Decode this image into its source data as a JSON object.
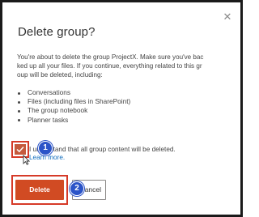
{
  "dialog": {
    "title": "Delete group?",
    "close_icon": "close-icon",
    "description_lines": [
      "You're about to delete the group ProjectX. Make sure you've bac",
      "ked up all your files. If you continue, everything related to this gr",
      "oup will be deleted, including:"
    ],
    "items": [
      "Conversations",
      "Files (including files in SharePoint)",
      "The group notebook",
      "Planner tasks"
    ],
    "acknowledgement": "I understand that all group content will be deleted.",
    "learn_more": "Learn more.",
    "checkbox_checked": true,
    "delete_label": "Delete",
    "cancel_label": "Cancel"
  },
  "annotations": {
    "step1": "1",
    "step2": "2"
  },
  "colors": {
    "accent": "#c55a3d",
    "highlight": "#d63a28",
    "badge": "#2b54c8",
    "delete_button": "#d14b23"
  }
}
